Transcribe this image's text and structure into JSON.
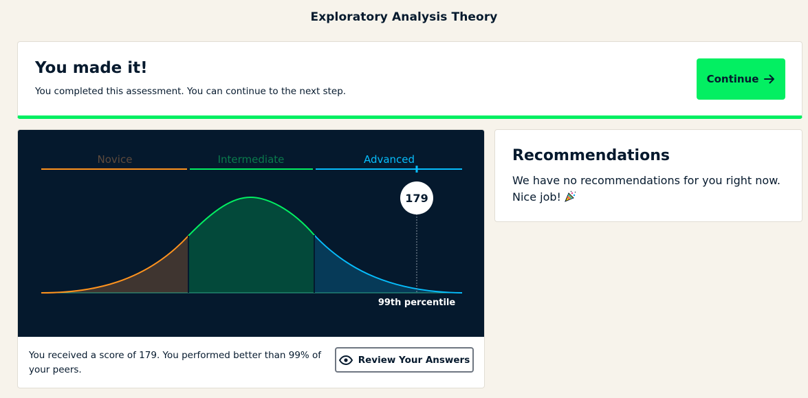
{
  "header": {
    "title": "Exploratory Analysis Theory"
  },
  "status": {
    "heading": "You made it!",
    "message": "You completed this assessment. You can continue to the next step.",
    "continue_label": "Continue",
    "accent_color": "#03ef62"
  },
  "score_chart": {
    "levels": [
      {
        "name": "Novice",
        "color": "#ff931e"
      },
      {
        "name": "Intermediate",
        "color": "#03ef62"
      },
      {
        "name": "Advanced",
        "color": "#06bdfc"
      }
    ],
    "score": "179",
    "percentile_label": "99th percentile",
    "background": "#05192d"
  },
  "score_summary": {
    "text": "You received a score of 179. You performed better than 99% of your peers.",
    "review_label": "Review Your Answers"
  },
  "recommendations": {
    "title": "Recommendations",
    "message_line1": "We have no recommendations for you right now.",
    "message_line2": "Nice job!",
    "emoji_icon": "party-popper-icon"
  }
}
